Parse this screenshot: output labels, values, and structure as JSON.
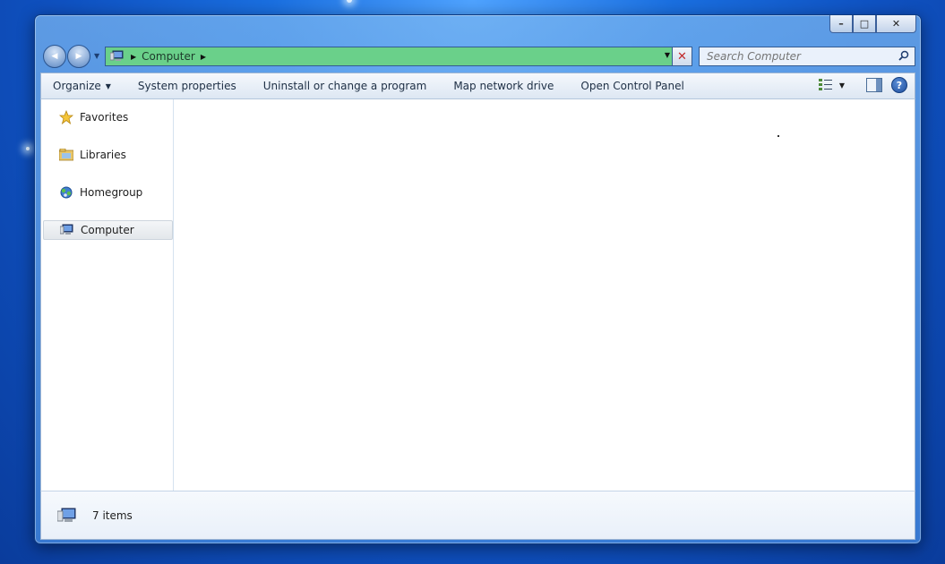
{
  "window": {
    "caption_buttons": {
      "minimize": "–",
      "maximize": "□",
      "close": "✕"
    }
  },
  "navigation": {
    "back_icon": "◀",
    "forward_icon": "▶"
  },
  "address_bar": {
    "path": [
      "Computer"
    ],
    "background_color": "#6ad08a"
  },
  "search": {
    "placeholder": "Search Computer"
  },
  "toolbar": {
    "items": [
      {
        "label": "Organize",
        "has_dropdown": true
      },
      {
        "label": "System properties"
      },
      {
        "label": "Uninstall or change a program"
      },
      {
        "label": "Map network drive"
      },
      {
        "label": "Open Control Panel"
      }
    ],
    "help_label": "?"
  },
  "nav_pane": {
    "items": [
      {
        "label": "Favorites",
        "icon": "star-icon"
      },
      {
        "label": "Libraries",
        "icon": "library-folder-icon"
      },
      {
        "label": "Homegroup",
        "icon": "homegroup-icon"
      },
      {
        "label": "Computer",
        "icon": "computer-icon",
        "selected": true
      }
    ]
  },
  "details": {
    "item_count": "7 items"
  }
}
